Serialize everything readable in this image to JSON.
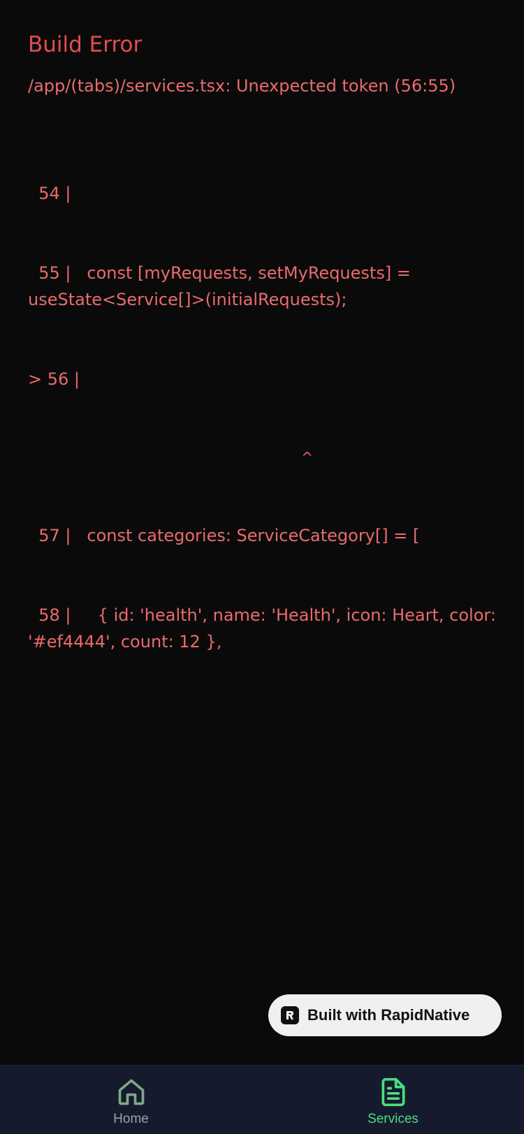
{
  "error": {
    "title": "Build Error",
    "message": "/app/(tabs)/services.tsx: Unexpected token (56:55)",
    "code_lines": [
      "  54 |",
      "  55 |   const [myRequests, setMyRequests] = useState<Service[]>(initialRequests);",
      "> 56 |",
      "^",
      "  57 |   const categories: ServiceCategory[] = [",
      "  58 |     { id: 'health', name: 'Health', icon: Heart, color: '#ef4444', count: 12 },"
    ]
  },
  "badge": {
    "label": "Built with RapidNative"
  },
  "tabs": [
    {
      "label": "Home",
      "icon": "home-icon",
      "active": false
    },
    {
      "label": "Services",
      "icon": "document-icon",
      "active": true
    }
  ],
  "colors": {
    "error_title": "#e24d4d",
    "error_text": "#ea6b6b",
    "background": "#0a0a0b",
    "tabbar": "#161a2d",
    "active_tab": "#4ade80",
    "inactive_tab": "#7fa88a"
  }
}
